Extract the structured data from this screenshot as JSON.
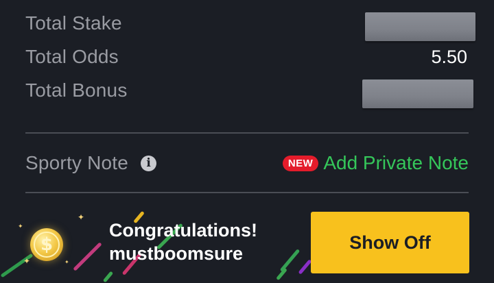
{
  "summary": {
    "total_stake_label": "Total Stake",
    "total_odds_label": "Total Odds",
    "total_odds_value": "5.50",
    "total_bonus_label": "Total Bonus"
  },
  "note": {
    "label": "Sporty Note",
    "info_icon": "info-icon",
    "new_badge": "NEW",
    "add_link": "Add Private Note"
  },
  "promo": {
    "line1": "Congratulations!",
    "line2": "mustboomsure",
    "coin_symbol": "$",
    "button_label": "Show Off"
  },
  "colors": {
    "background": "#1b1e25",
    "accent_green": "#35c75a",
    "badge_red": "#e41c2b",
    "button_yellow": "#f8c11d"
  }
}
